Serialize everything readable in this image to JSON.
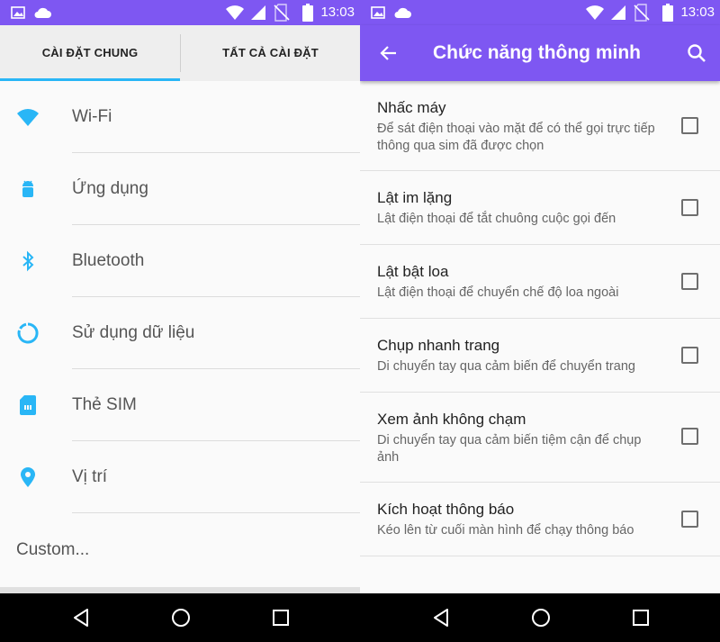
{
  "colors": {
    "accent": "#7e57f2",
    "icon_blue": "#29b6f6",
    "nav_bg": "#000000"
  },
  "status_bar": {
    "time_left": "13:03",
    "time_right": "13:03",
    "icons": [
      "image-icon",
      "cloud-icon",
      "wifi-icon",
      "signal-icon",
      "no-sim-icon",
      "battery-icon"
    ]
  },
  "left": {
    "tabs": [
      {
        "label": "CÀI ĐẶT CHUNG",
        "active": true
      },
      {
        "label": "TẤT CẢ CÀI ĐẶT",
        "active": false
      }
    ],
    "items": [
      {
        "label": "Wi-Fi",
        "icon": "wifi-icon"
      },
      {
        "label": "Ứng dụng",
        "icon": "android-icon"
      },
      {
        "label": "Bluetooth",
        "icon": "bluetooth-icon"
      },
      {
        "label": "Sử dụng dữ liệu",
        "icon": "data-usage-icon"
      },
      {
        "label": "Thẻ SIM",
        "icon": "sim-card-icon"
      },
      {
        "label": "Vị trí",
        "icon": "location-icon"
      }
    ],
    "custom": "Custom..."
  },
  "right": {
    "title": "Chức năng thông minh",
    "items": [
      {
        "title": "Nhấc máy",
        "subtitle": "Để sát điện thoại vào mặt để có thể gọi trực tiếp thông qua sim đã được chọn",
        "checked": false
      },
      {
        "title": "Lật im lặng",
        "subtitle": "Lật điện thoại để tắt chuông cuộc gọi đến",
        "checked": false
      },
      {
        "title": "Lật bật loa",
        "subtitle": "Lật điện thoại để chuyển chế độ loa ngoài",
        "checked": false
      },
      {
        "title": "Chụp nhanh trang",
        "subtitle": "Di chuyển tay qua cảm biến để chuyển trang",
        "checked": false
      },
      {
        "title": "Xem ảnh không chạm",
        "subtitle": "Di chuyển tay qua cảm biến tiệm cận để chụp ảnh",
        "checked": false
      },
      {
        "title": "Kích hoạt thông báo",
        "subtitle": "Kéo lên từ cuối màn hình để chạy thông báo",
        "checked": false
      }
    ]
  },
  "nav": [
    "back-icon",
    "home-icon",
    "recents-icon"
  ]
}
